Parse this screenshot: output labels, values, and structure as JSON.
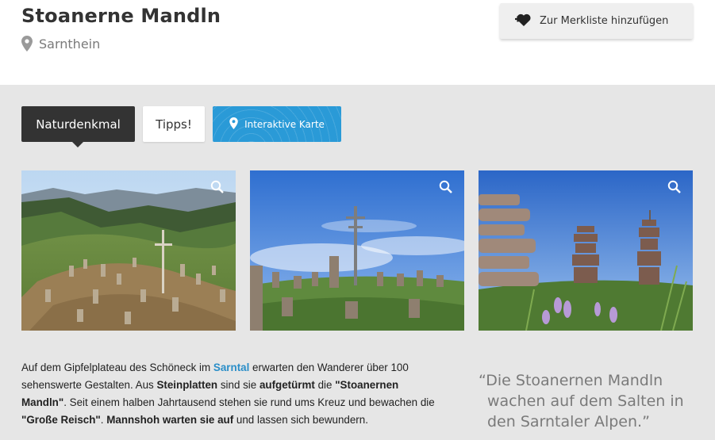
{
  "header": {
    "title": "Stoanerne Mandln",
    "location": "Sarnthein",
    "merkliste_label": "Zur Merkliste hinzufügen"
  },
  "tabs": [
    {
      "label": "Naturdenkmal",
      "active": true
    },
    {
      "label": "Tipps!",
      "active": false
    },
    {
      "label": "Interaktive Karte",
      "active": false
    }
  ],
  "colors": {
    "accent": "#2a9ad7",
    "link": "#2a8ec8",
    "dark": "#333333",
    "panel": "#e6e6e6"
  },
  "icons": {
    "location": "map-pin-icon",
    "merkliste": "heart-plus-icon",
    "map_tab": "map-pin-icon",
    "zoom": "magnifier-icon"
  },
  "description": {
    "t1": "Auf dem Gipfelplateau des Schöneck im ",
    "link": "Sarntal",
    "t2": " erwarten den Wanderer über 100 sehenswerte Gestalten. Aus ",
    "b1": "Steinplatten",
    "t3": " sind sie ",
    "b2": "aufgetürmt",
    "t4": " die ",
    "b3": "\"Stoanernen Mandln\"",
    "t5": ". Seit einem halben Jahrtausend stehen sie rund ums Kreuz und bewachen die ",
    "b4": "\"Große Reisch\"",
    "t6": ". ",
    "b5": "Mannshoh warten sie auf",
    "t7": " und lassen sich bewundern."
  },
  "quote": {
    "line1": "“Die Stoanernen Mandln",
    "line2": "wachen auf dem Salten in",
    "line3": "den Sarntaler Alpen.”"
  }
}
